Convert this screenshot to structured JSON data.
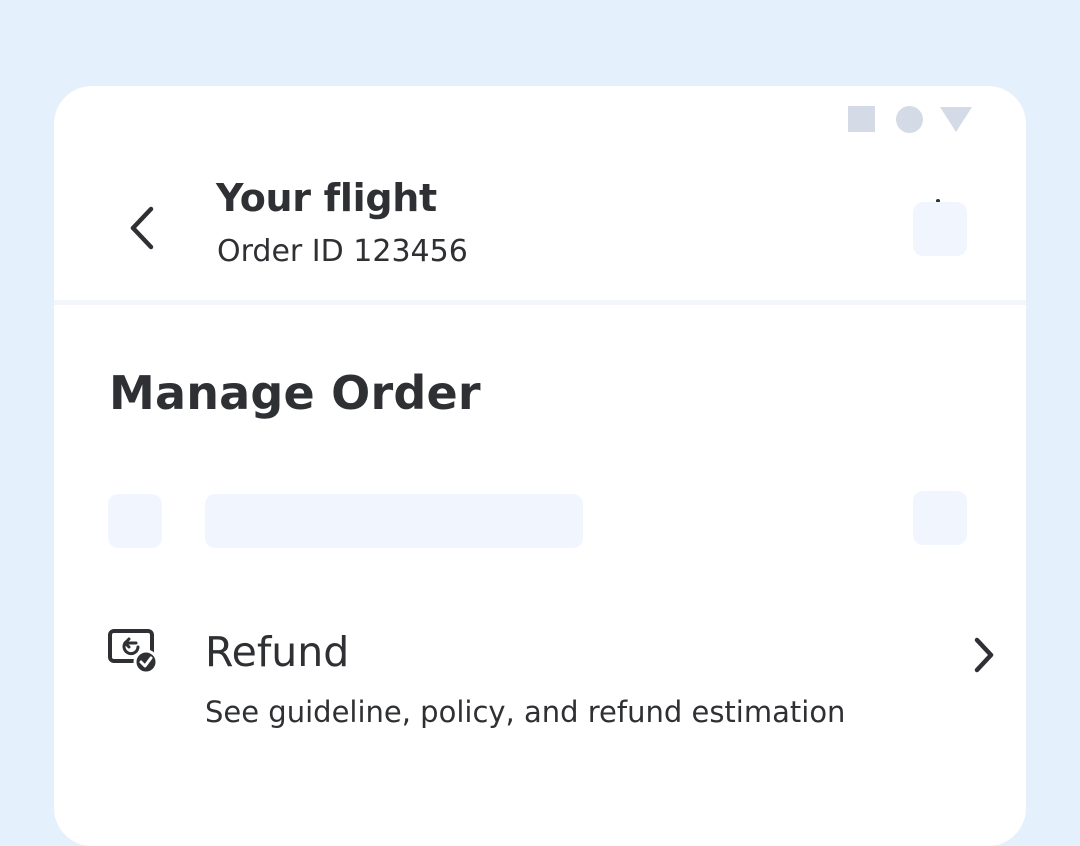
{
  "header": {
    "title": "Your flight",
    "subtitle": "Order ID 123456",
    "back_icon": "chevron-left-icon"
  },
  "section": {
    "title": "Manage Order"
  },
  "refund": {
    "label": "Refund",
    "description": "See guideline, policy, and refund estimation",
    "icon": "refund-money-icon",
    "chevron_icon": "chevron-right-icon"
  },
  "colors": {
    "background": "#E4F0FC",
    "card": "#FFFFFF",
    "text": "#2F3033",
    "skeleton": "#F1F6FE",
    "status_shapes": "#D4DAE6"
  }
}
